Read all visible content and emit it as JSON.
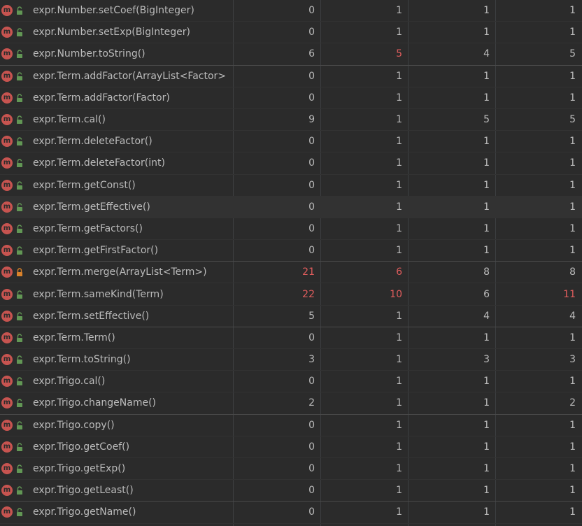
{
  "metrics_table": {
    "rows": [
      {
        "method": "expr.Number.setCoef(BigInteger)",
        "v1": "0",
        "v2": "1",
        "v3": "1",
        "v4": "1",
        "vis": "public",
        "red": []
      },
      {
        "method": "expr.Number.setExp(BigInteger)",
        "v1": "0",
        "v2": "1",
        "v3": "1",
        "v4": "1",
        "vis": "public",
        "red": []
      },
      {
        "method": "expr.Number.toString()",
        "v1": "6",
        "v2": "5",
        "v3": "4",
        "v4": "5",
        "vis": "public",
        "red": [
          "v2"
        ]
      },
      {
        "method": "expr.Term.addFactor(ArrayList<Factor>",
        "v1": "0",
        "v2": "1",
        "v3": "1",
        "v4": "1",
        "vis": "public",
        "red": []
      },
      {
        "method": "expr.Term.addFactor(Factor)",
        "v1": "0",
        "v2": "1",
        "v3": "1",
        "v4": "1",
        "vis": "public",
        "red": []
      },
      {
        "method": "expr.Term.cal()",
        "v1": "9",
        "v2": "1",
        "v3": "5",
        "v4": "5",
        "vis": "public",
        "red": []
      },
      {
        "method": "expr.Term.deleteFactor()",
        "v1": "0",
        "v2": "1",
        "v3": "1",
        "v4": "1",
        "vis": "public",
        "red": []
      },
      {
        "method": "expr.Term.deleteFactor(int)",
        "v1": "0",
        "v2": "1",
        "v3": "1",
        "v4": "1",
        "vis": "public",
        "red": []
      },
      {
        "method": "expr.Term.getConst()",
        "v1": "0",
        "v2": "1",
        "v3": "1",
        "v4": "1",
        "vis": "public",
        "red": []
      },
      {
        "method": "expr.Term.getEffective()",
        "v1": "0",
        "v2": "1",
        "v3": "1",
        "v4": "1",
        "vis": "public",
        "red": [],
        "selected": true
      },
      {
        "method": "expr.Term.getFactors()",
        "v1": "0",
        "v2": "1",
        "v3": "1",
        "v4": "1",
        "vis": "public",
        "red": []
      },
      {
        "method": "expr.Term.getFirstFactor()",
        "v1": "0",
        "v2": "1",
        "v3": "1",
        "v4": "1",
        "vis": "public",
        "red": []
      },
      {
        "method": "expr.Term.merge(ArrayList<Term>)",
        "v1": "21",
        "v2": "6",
        "v3": "8",
        "v4": "8",
        "vis": "private",
        "red": [
          "v1",
          "v2"
        ]
      },
      {
        "method": "expr.Term.sameKind(Term)",
        "v1": "22",
        "v2": "10",
        "v3": "6",
        "v4": "11",
        "vis": "public",
        "red": [
          "v1",
          "v2",
          "v4"
        ]
      },
      {
        "method": "expr.Term.setEffective()",
        "v1": "5",
        "v2": "1",
        "v3": "4",
        "v4": "4",
        "vis": "public",
        "red": []
      },
      {
        "method": "expr.Term.Term()",
        "v1": "0",
        "v2": "1",
        "v3": "1",
        "v4": "1",
        "vis": "public",
        "red": []
      },
      {
        "method": "expr.Term.toString()",
        "v1": "3",
        "v2": "1",
        "v3": "3",
        "v4": "3",
        "vis": "public",
        "red": []
      },
      {
        "method": "expr.Trigo.cal()",
        "v1": "0",
        "v2": "1",
        "v3": "1",
        "v4": "1",
        "vis": "public",
        "red": []
      },
      {
        "method": "expr.Trigo.changeName()",
        "v1": "2",
        "v2": "1",
        "v3": "1",
        "v4": "2",
        "vis": "public",
        "red": []
      },
      {
        "method": "expr.Trigo.copy()",
        "v1": "0",
        "v2": "1",
        "v3": "1",
        "v4": "1",
        "vis": "public",
        "red": []
      },
      {
        "method": "expr.Trigo.getCoef()",
        "v1": "0",
        "v2": "1",
        "v3": "1",
        "v4": "1",
        "vis": "public",
        "red": []
      },
      {
        "method": "expr.Trigo.getExp()",
        "v1": "0",
        "v2": "1",
        "v3": "1",
        "v4": "1",
        "vis": "public",
        "red": []
      },
      {
        "method": "expr.Trigo.getLeast()",
        "v1": "0",
        "v2": "1",
        "v3": "1",
        "v4": "1",
        "vis": "public",
        "red": []
      },
      {
        "method": "expr.Trigo.getName()",
        "v1": "0",
        "v2": "1",
        "v3": "1",
        "v4": "1",
        "vis": "public",
        "red": []
      }
    ]
  },
  "icons": {
    "method": "method-icon",
    "method_letter": "m",
    "public": "unlocked-padlock-icon",
    "private": "locked-padlock-icon"
  },
  "colors": {
    "background": "#2b2b2b",
    "text": "#bbbbbb",
    "highlight": "#e05d5d",
    "method_icon": "#c75450",
    "public_lock": "#629755",
    "private_lock": "#d9822b"
  }
}
